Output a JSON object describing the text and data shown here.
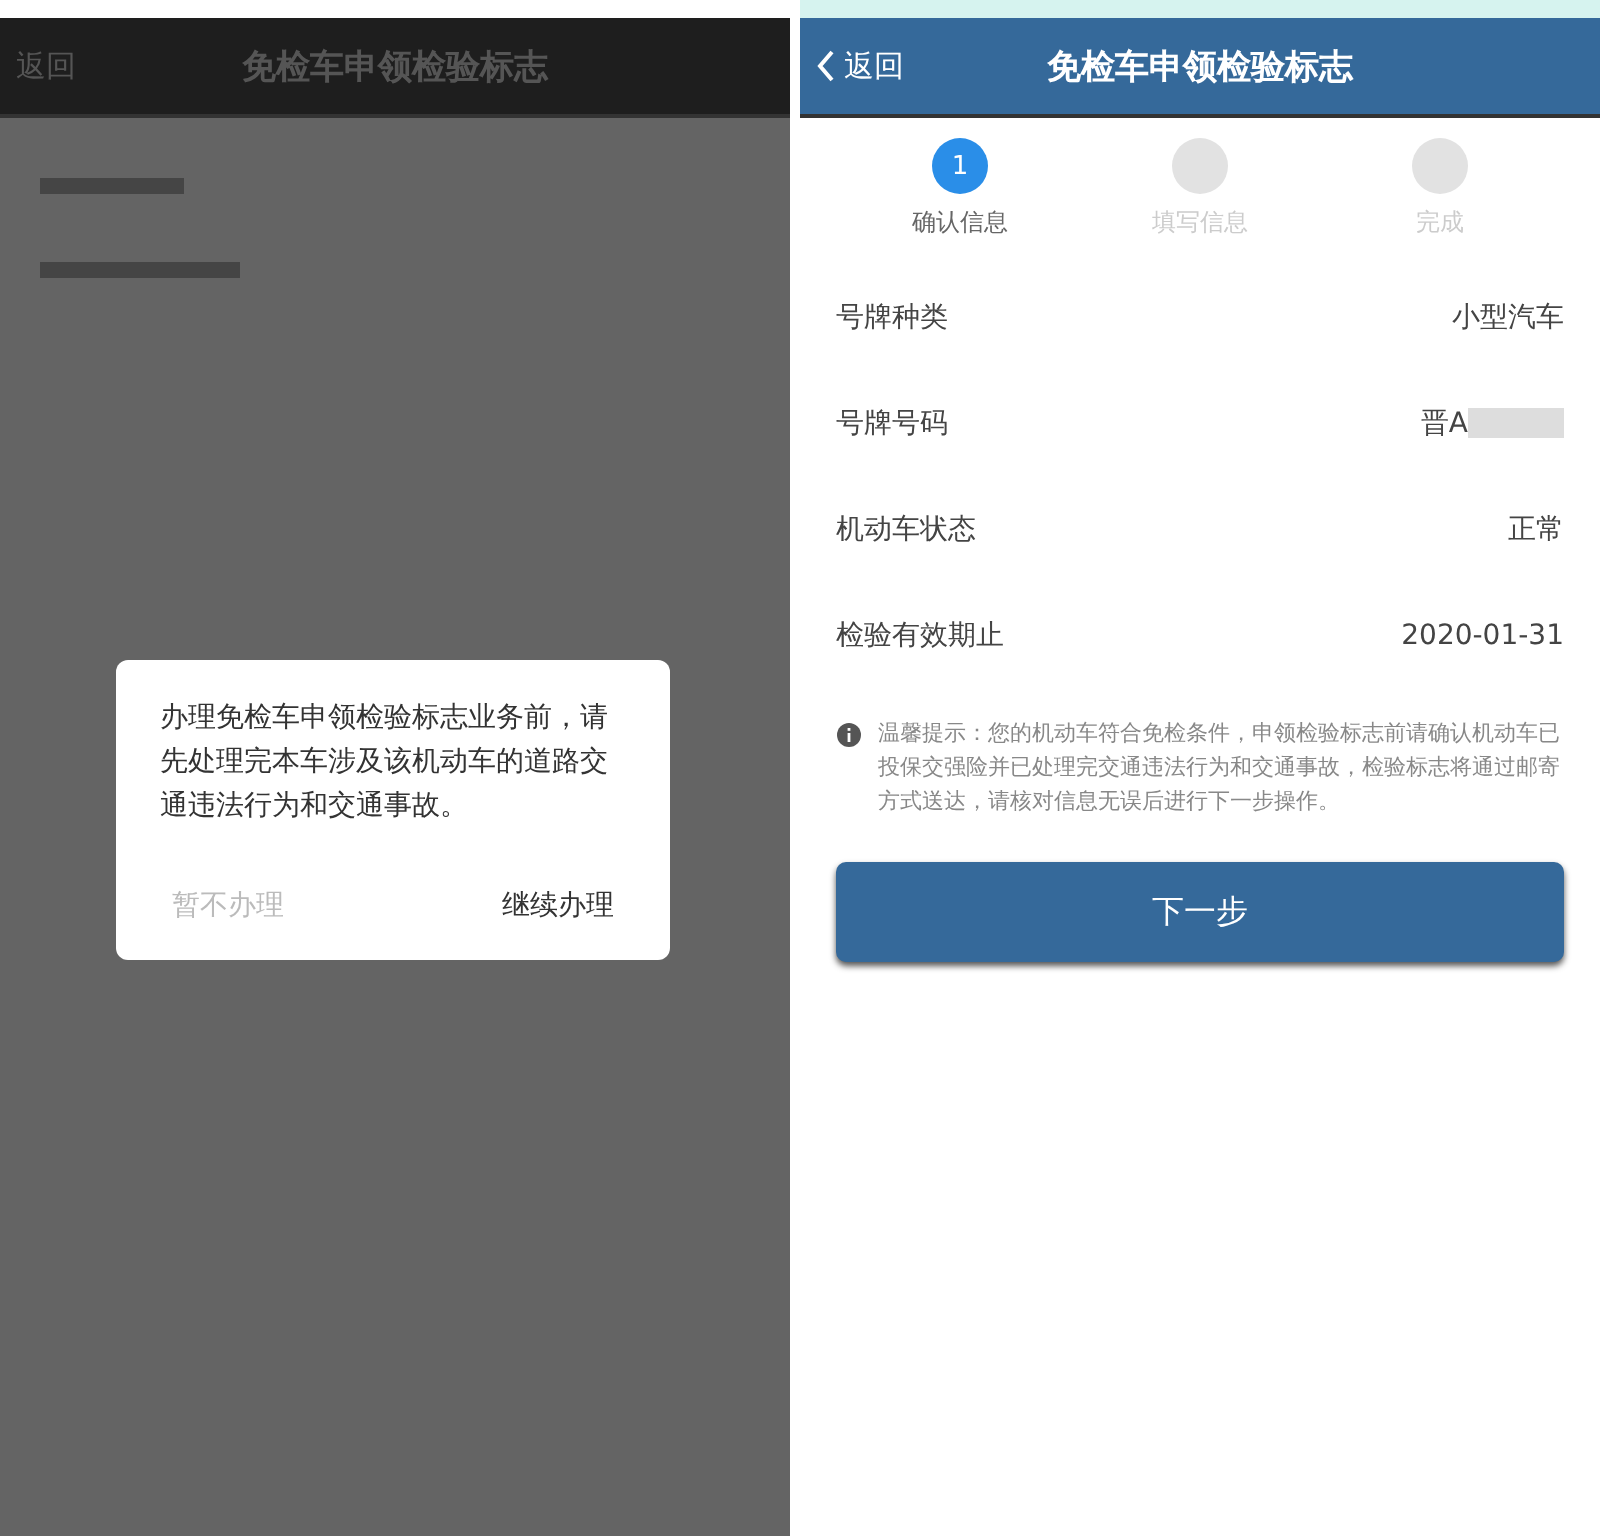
{
  "left_screen": {
    "header": {
      "back": "返回",
      "title": "免检车申领检验标志"
    },
    "dialog": {
      "message": "办理免检车申领检验标志业务前，请先处理完本车涉及该机动车的道路交通违法行为和交通事故。",
      "buttons": [
        {
          "label": "暂不办理",
          "disabled": true
        },
        {
          "label": "继续办理",
          "disabled": false
        }
      ]
    }
  },
  "right_screen": {
    "header": {
      "back": "返回",
      "title": "免检车申领检验标志"
    },
    "steps": [
      {
        "number": "1",
        "label": "确认信息",
        "selected": true
      },
      {
        "label": "填写信息",
        "selected": false
      },
      {
        "label": "完成",
        "selected": false
      }
    ],
    "fields": [
      {
        "label": "号牌种类",
        "value": "小型汽车",
        "masked": false
      },
      {
        "label": "号牌号码",
        "value": "晋A",
        "masked": true
      },
      {
        "label": "机动车状态",
        "value": "正常",
        "masked": false
      },
      {
        "label": "检验有效期止",
        "value": "2020-01-31",
        "masked": false
      }
    ],
    "notice": "温馨提示：您的机动车符合免检条件，申领检验标志前请确认机动车已投保交强险并已处理完交通违法行为和交通事故，检验标志将通过邮寄方式送达，请核对信息无误后进行下一步操作。",
    "next_button": "下一步"
  }
}
